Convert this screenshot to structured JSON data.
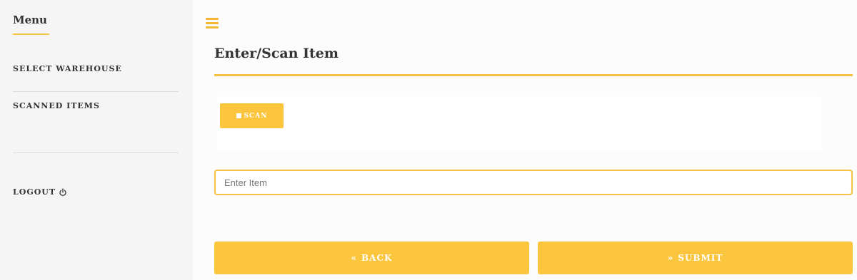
{
  "sidebar": {
    "title": "Menu",
    "items": [
      {
        "label": "SELECT WAREHOUSE"
      },
      {
        "label": "SCANNED ITEMS"
      }
    ],
    "logout": {
      "label": "LOGOUT",
      "icon": "power-icon"
    }
  },
  "header": {
    "menu_icon": "hamburger-icon",
    "title": "Enter/Scan Item"
  },
  "scan": {
    "label": "SCAN",
    "icon": "square-icon"
  },
  "item_input": {
    "placeholder": "Enter Item",
    "value": ""
  },
  "actions": {
    "back_label": "BACK",
    "back_icon": "double-chevron-left-icon",
    "submit_label": "SUBMIT",
    "submit_icon": "double-chevron-right-icon"
  },
  "colors": {
    "accent": "#fbc53e",
    "sidebar_bg": "#f5f5f6",
    "text": "#333333"
  }
}
